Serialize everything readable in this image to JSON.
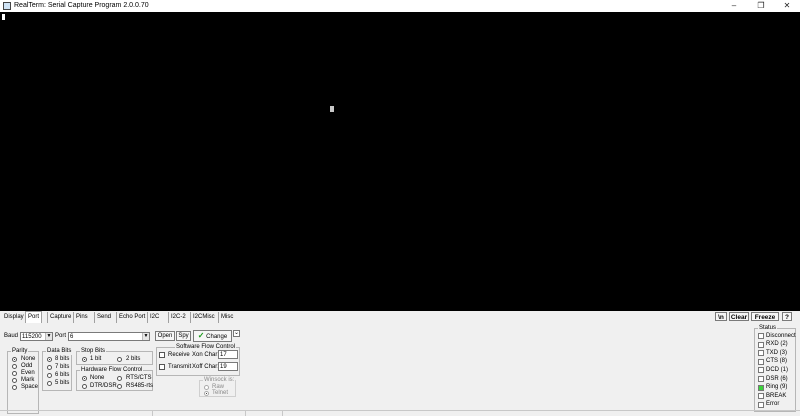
{
  "window": {
    "title": "RealTerm: Serial Capture Program 2.0.0.70",
    "controls": [
      "–",
      "❐",
      "✕"
    ]
  },
  "tabs": [
    "Display",
    "Port",
    "Capture",
    "Pins",
    "Send",
    "Echo Port",
    "I2C",
    "I2C-2",
    "I2CMisc",
    "Misc"
  ],
  "toolbar": {
    "newline_label": "\\n",
    "clear_label": "Clear",
    "freeze_label": "Freeze",
    "help_label": "?"
  },
  "port": {
    "baud_label": "Baud",
    "baud_value": "115200",
    "port_label": "Port",
    "port_value": "6",
    "open_label": "Open",
    "spy_label": "Spy",
    "change_label": "Change",
    "parity": {
      "title": "Parity",
      "options": [
        "None",
        "Odd",
        "Even",
        "Mark",
        "Space"
      ]
    },
    "data_bits": {
      "title": "Data Bits",
      "options": [
        "8 bits",
        "7 bits",
        "6 bits",
        "5 bits"
      ]
    },
    "stop_bits": {
      "title": "Stop Bits",
      "options": [
        "1 bit",
        "2 bits"
      ]
    },
    "hw_flow": {
      "title": "Hardware Flow Control",
      "options": [
        "None",
        "RTS/CTS",
        "DTR/DSR",
        "RS485-rts"
      ]
    },
    "sw_flow": {
      "title": "Software Flow Control",
      "receive_label": "Receive",
      "transmit_label": "Transmit",
      "xon_label": "Xon Char:",
      "xon_value": "17",
      "xoff_label": "Xoff Char:",
      "xoff_value": "19"
    },
    "winsock": {
      "title": "Winsock is:",
      "options": [
        "Raw",
        "Telnet"
      ]
    }
  },
  "status": {
    "title": "Status",
    "items": [
      {
        "label": "Disconnect",
        "on": false
      },
      {
        "label": "RXD (2)",
        "on": false
      },
      {
        "label": "TXD (3)",
        "on": false
      },
      {
        "label": "CTS (8)",
        "on": false
      },
      {
        "label": "DCD (1)",
        "on": false
      },
      {
        "label": "DSR (6)",
        "on": false
      },
      {
        "label": "Ring (9)",
        "on": true
      },
      {
        "label": "BREAK",
        "on": false
      },
      {
        "label": "Error",
        "on": false
      }
    ],
    "led_on_color": "#3ad23a"
  }
}
